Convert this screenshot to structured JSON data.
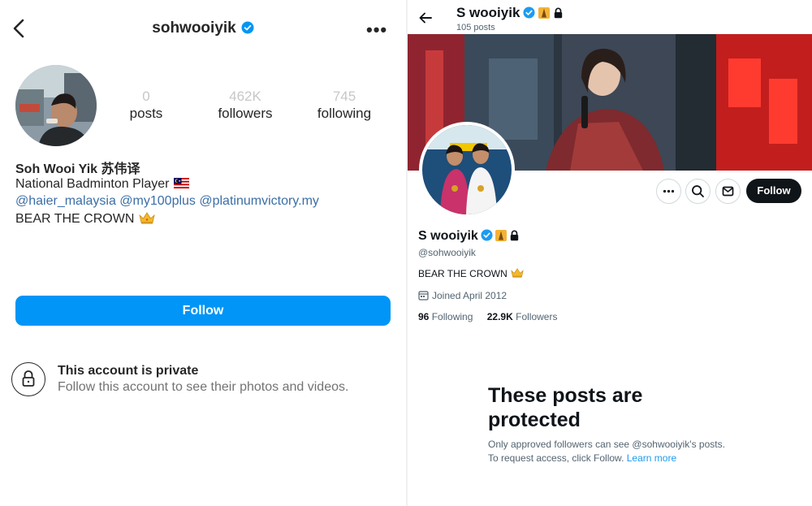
{
  "instagram": {
    "username": "sohwooiyik",
    "stats": [
      {
        "value": "0",
        "label": "posts"
      },
      {
        "value": "462K",
        "label": "followers"
      },
      {
        "value": "745",
        "label": "following"
      }
    ],
    "full_name": "Soh Wooi Yik 苏伟译",
    "bio_line1": "National Badminton Player",
    "bio_mentions": "@haier_malaysia @my100plus @platinumvictory.my",
    "bio_line3": "BEAR THE CROWN",
    "follow_label": "Follow",
    "private_title": "This account is private",
    "private_subtitle": "Follow this account to see their photos and videos.",
    "colors": {
      "follow_button": "#0095f6",
      "mention_link": "#3b6ea8"
    }
  },
  "x": {
    "display_name": "S wooiyik",
    "post_count": "105 posts",
    "handle": "@sohwooiyik",
    "bio": "BEAR THE CROWN",
    "joined": "Joined April 2012",
    "following_count": "96",
    "following_label": "Following",
    "followers_count": "22.9K",
    "followers_label": "Followers",
    "follow_label": "Follow",
    "protected_title": "These posts are protected",
    "protected_text": "Only approved followers can see @sohwooiyik's posts. To request access, click Follow.",
    "learn_more": "Learn more",
    "colors": {
      "follow_button": "#0f1419",
      "link": "#1d9bf0"
    }
  }
}
